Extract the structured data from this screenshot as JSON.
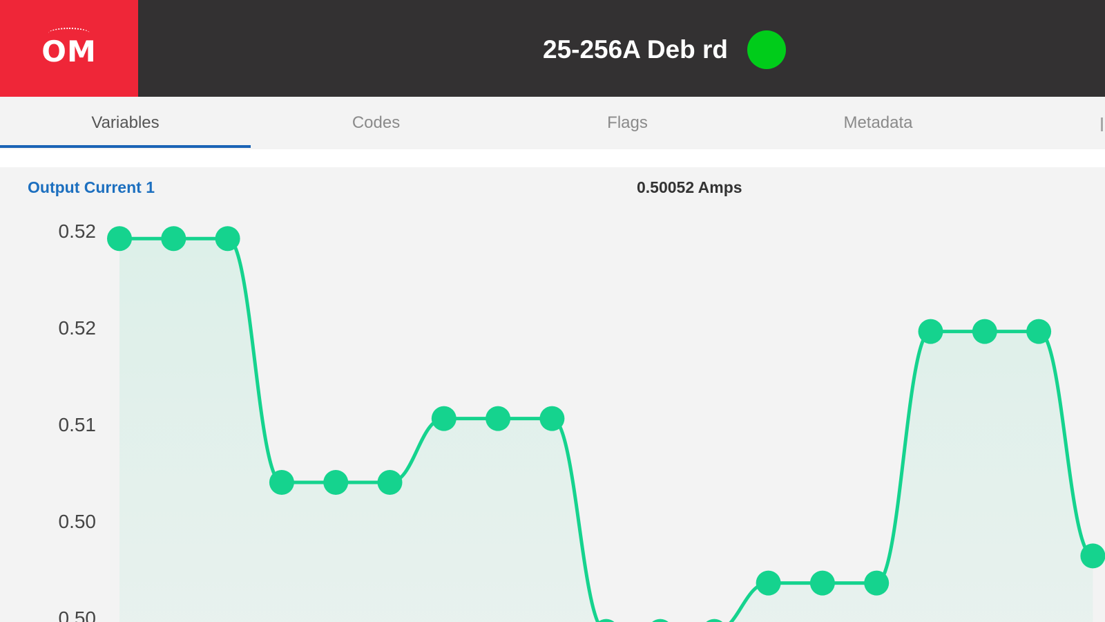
{
  "header": {
    "logo_text": "OM",
    "device_title": "25-256A Deb rd",
    "status_color": "#00cc1a",
    "logo_color": "#ef2638",
    "bar_color": "#333132"
  },
  "tabs": [
    {
      "label": "Variables",
      "active": true
    },
    {
      "label": "Codes",
      "active": false
    },
    {
      "label": "Flags",
      "active": false
    },
    {
      "label": "Metadata",
      "active": false
    }
  ],
  "variable": {
    "name": "Output Current 1",
    "value": "0.50052 Amps"
  },
  "chart_data": {
    "type": "line",
    "title": "",
    "xlabel": "",
    "ylabel": "",
    "y_tick_labels": [
      "0.52",
      "0.52",
      "0.51",
      "0.50",
      "0.50"
    ],
    "y_tick_values": [
      0.5225,
      0.5175,
      0.5125,
      0.5075,
      0.5025
    ],
    "ylim": [
      0.5025,
      0.5225
    ],
    "line_color": "#15d38e",
    "fill": true,
    "smooth": true,
    "grid": false,
    "series": [
      {
        "values": [
          0.5221,
          0.5221,
          0.5221,
          0.5095,
          0.5095,
          0.5095,
          0.5128,
          0.5128,
          0.5128,
          0.5018,
          0.5018,
          0.5018,
          0.5043,
          0.5043,
          0.5043,
          0.5173,
          0.5173,
          0.5173,
          0.5057
        ]
      }
    ]
  }
}
